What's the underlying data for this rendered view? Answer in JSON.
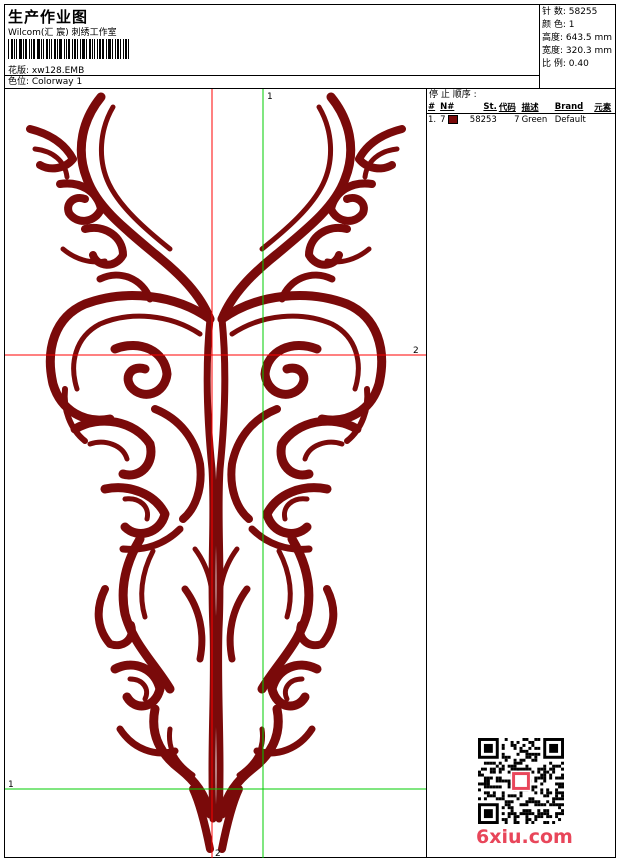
{
  "header": {
    "title": "生产作业图",
    "company": "Wilcom(汇 宸) 刺绣工作室",
    "design": "花版: xw128.EMB",
    "colorway": "色位: Colorway 1"
  },
  "stats": {
    "stitches": "针 数: 58255",
    "colors": "颜 色: 1",
    "height": "高度: 643.5 mm",
    "width": "宽度: 320.3 mm",
    "scale": "比 例: 0.40"
  },
  "sequence": {
    "title": "停 止 顺序 :",
    "headers": [
      "#",
      "N#",
      "St.",
      "代码",
      "描述",
      "Brand",
      "元素"
    ],
    "rows": [
      {
        "num": "1.",
        "needle": "7",
        "stitches": "58253",
        "code": "7",
        "desc": "Green",
        "brand": "Default",
        "elem": "",
        "color": "#7a0a0a"
      }
    ]
  },
  "guides": {
    "v1": "1",
    "v2": "2",
    "h1": "1",
    "h2": "2"
  },
  "watermark": "6xiu.com",
  "colors": {
    "embroidery": "#7a0a0a",
    "guide_red": "#ff0000",
    "guide_green": "#00cc00"
  }
}
